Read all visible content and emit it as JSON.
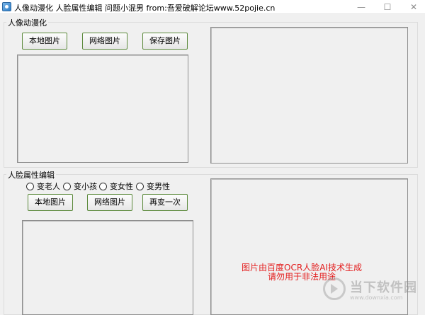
{
  "window": {
    "title": "人像动漫化 人脸属性编辑 问题小混男 from:吾爱破解论坛www.52pojie.cn",
    "min_glyph": "—",
    "max_glyph": "☐",
    "close_glyph": "✕"
  },
  "anime_group": {
    "label": "人像动漫化",
    "local_image_label": "本地图片",
    "web_image_label": "网络图片",
    "save_image_label": "保存图片"
  },
  "face_group": {
    "label": "人脸属性编辑",
    "radios": [
      {
        "label": "变老人",
        "checked": false
      },
      {
        "label": "变小孩",
        "checked": false
      },
      {
        "label": "变女性",
        "checked": false
      },
      {
        "label": "变男性",
        "checked": false
      }
    ],
    "local_image_label": "本地图片",
    "web_image_label": "网络图片",
    "redo_label": "再变一次"
  },
  "notice": {
    "line1": "图片由百度OCR人脸AI技术生成",
    "line2": "请勿用于非法用途",
    "color": "#e31c1c"
  },
  "watermark": {
    "text": "当下软件园",
    "sub": "www.downxia.com"
  }
}
